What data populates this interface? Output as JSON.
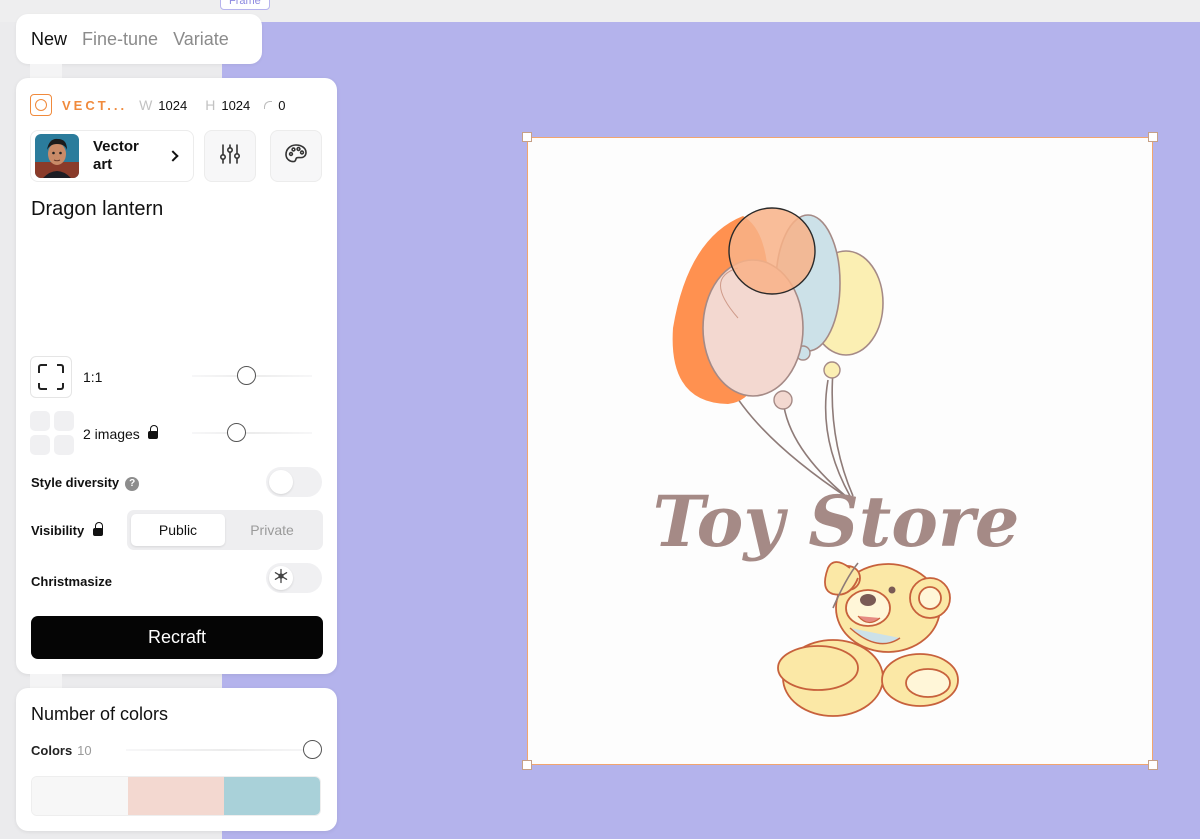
{
  "frame_tag": "Frame",
  "tabs": [
    {
      "label": "New",
      "active": true
    },
    {
      "label": "Fine-tune",
      "active": false
    },
    {
      "label": "Variate",
      "active": false
    }
  ],
  "settings": {
    "vector_label": "VECT...",
    "width_key": "W",
    "width": "1024",
    "height_key": "H",
    "height": "1024",
    "corner_radius": "0"
  },
  "style": {
    "name": "Vector art",
    "settings_icon": "sliders-icon",
    "palette_icon": "palette-icon"
  },
  "prompt": "Dragon lantern",
  "aspect": {
    "label": "1:1",
    "level": 0.45
  },
  "images": {
    "label": "2 images",
    "level": 0.35
  },
  "style_diversity": {
    "label": "Style diversity",
    "help": "?",
    "on": false
  },
  "visibility": {
    "label": "Visibility",
    "options": [
      "Public",
      "Private"
    ],
    "selected": "Public"
  },
  "christmasize": {
    "label": "Christmasize",
    "on": false,
    "icon": "snowflake-icon"
  },
  "recraft_button": "Recraft",
  "colors": {
    "title": "Number of colors",
    "label": "Colors",
    "count": "10",
    "level": 1.0,
    "swatches": [
      "#f7f7f7",
      "#f3d8d0",
      "#a9d1d9"
    ]
  },
  "canvas": {
    "logo_text": "Toy Store",
    "palette": {
      "orange": "#ff9150",
      "pink": "#f3d8d0",
      "blue": "#cce1e8",
      "yellow": "#fbefb3",
      "brown": "#a58a86",
      "outline": "#c7613c",
      "bear": "#fbe8a6"
    }
  },
  "colors_accent": {
    "brand_orange": "#f08a3c",
    "background": "#b4b3ec",
    "button": "#050505"
  }
}
